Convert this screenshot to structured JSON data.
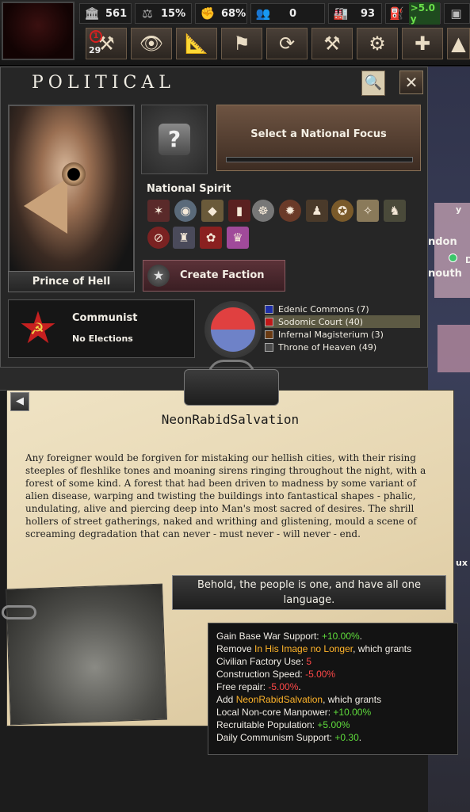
{
  "topbar": {
    "political_power": "561",
    "stability": "15%",
    "war_support": "68%",
    "manpower": "0",
    "factories": "93",
    "convoys": ">5.0 y",
    "alert_count": "1",
    "decisions_count": "29"
  },
  "political": {
    "title": "POLITICAL",
    "leader_name": "Prince of Hell",
    "focus_label": "Select a National Focus",
    "focus_progress": 0,
    "national_spirit_label": "National Spirit",
    "create_faction": "Create Faction",
    "ideology": "Communist",
    "elections": "No Elections",
    "parties": [
      {
        "name": "Edenic Commons (7)",
        "color": "#1e2fa8"
      },
      {
        "name": "Sodomic Court (40)",
        "color": "#c01818"
      },
      {
        "name": "Infernal Magisterium (3)",
        "color": "#6a3a12"
      },
      {
        "name": "Throne of Heaven (49)",
        "color": "#4a4a4a"
      }
    ]
  },
  "map": {
    "label_1": "ndon",
    "label_2": "nouth",
    "label_3": "D",
    "label_4": "y",
    "label_5": "ux"
  },
  "event": {
    "title": "NeonRabidSalvation",
    "description": "Any foreigner would be forgiven for mistaking our hellish cities, with their rising steeples of fleshlike tones and moaning sirens ringing throughout the night, with a forest of some kind. A forest that had been driven to madness by some variant of alien disease, warping and twisting the buildings into fantastical shapes - phalic, undulating, alive and piercing deep into Man's most sacred of desires. The shrill hollers of street gatherings, naked and writhing and glistening, mould a scene of screaming degradation that can never - must never - will never - end.",
    "option_label_1": "Behold, the people is one, and have all one",
    "option_label_2": "language."
  },
  "tooltip": {
    "l1a": "Gain Base War Support: ",
    "l1b": "+10.00%",
    "l1c": ".",
    "l2a": "Remove ",
    "l2b": "In His Image no Longer",
    "l2c": ", which grants",
    "l3a": "Civilian Factory Use: ",
    "l3b": "5",
    "l4a": "Construction Speed: ",
    "l4b": "-5.00%",
    "l5a": "Free repair: ",
    "l5b": "-5.00%",
    "l5c": ".",
    "l6a": "Add ",
    "l6b": "NeonRabidSalvation",
    "l6c": ", which grants",
    "l7a": "Local Non-core Manpower: ",
    "l7b": "+10.00%",
    "l8a": "Recruitable Population: ",
    "l8b": "+5.00%",
    "l9a": "Daily Communism Support: ",
    "l9b": "+0.30",
    "l9c": "."
  }
}
